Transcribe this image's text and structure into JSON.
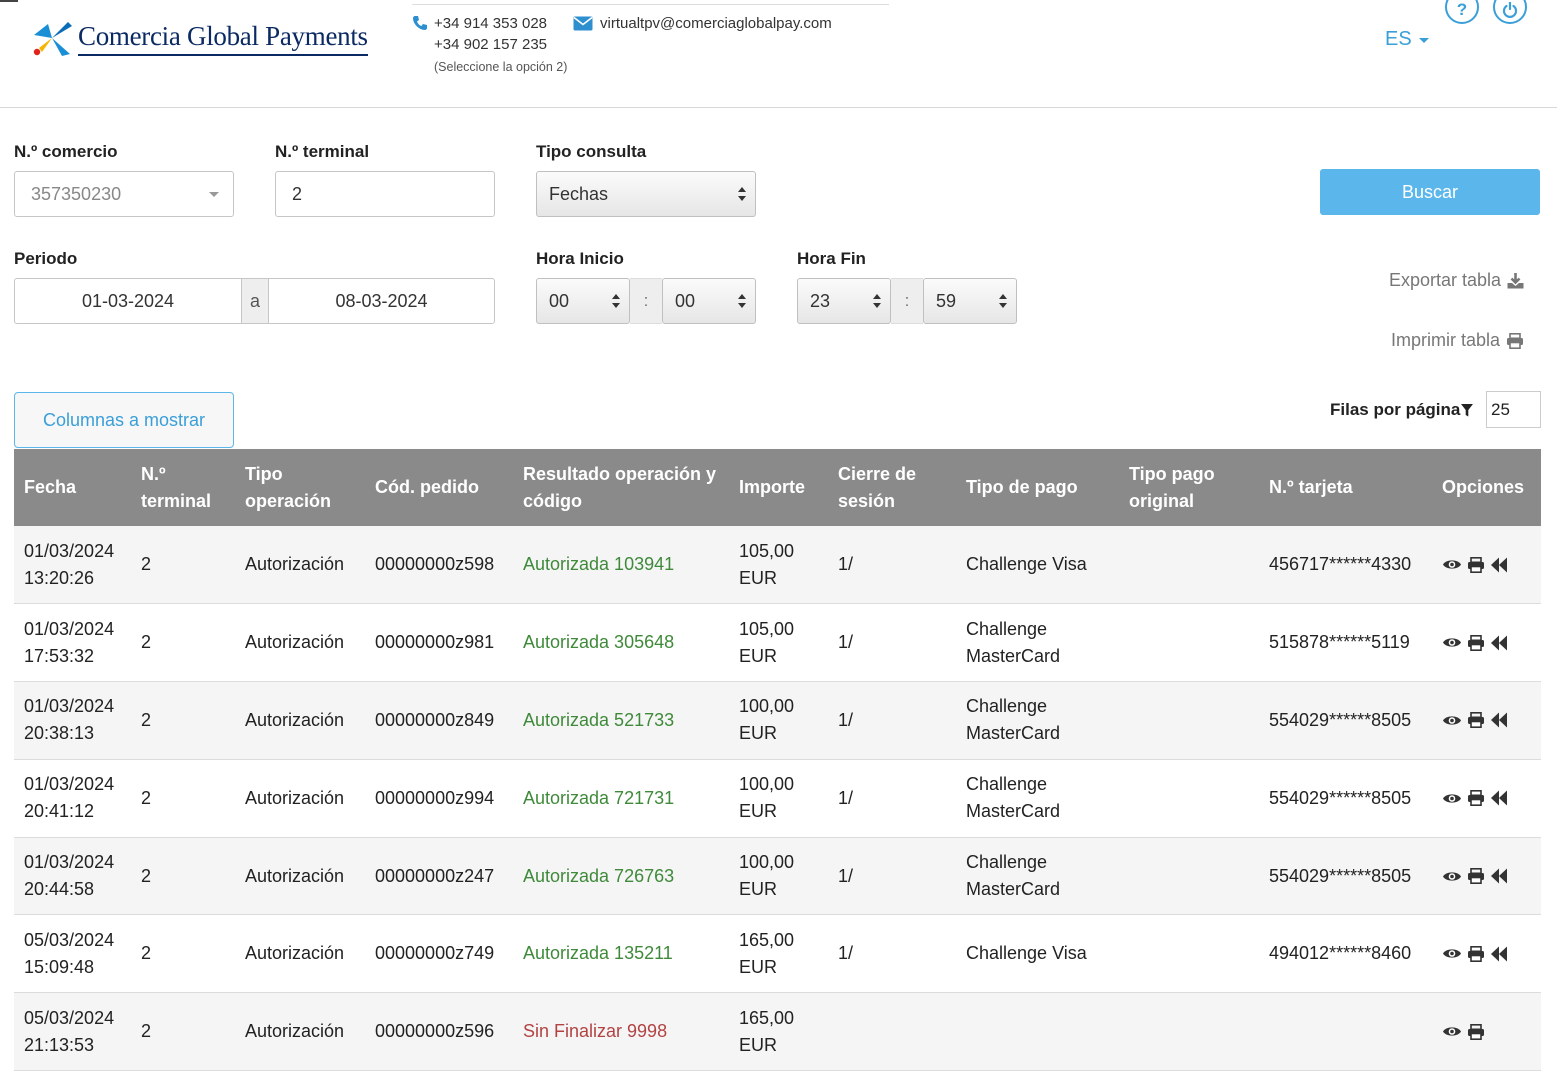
{
  "header": {
    "logo_text": "Comercia Global Payments",
    "phone1": "+34 914 353 028",
    "email": "virtualtpv@comerciaglobalpay.com",
    "phone2": "+34 902 157 235",
    "phone_note": "(Seleccione la opción 2)",
    "language": "ES",
    "help_label": "?"
  },
  "form": {
    "comercio_label": "N.º comercio",
    "comercio_value": "357350230",
    "terminal_label": "N.º terminal",
    "terminal_value": "2",
    "tipo_label": "Tipo consulta",
    "tipo_value": "Fechas",
    "periodo_label": "Periodo",
    "fecha_desde": "01-03-2024",
    "separator": "a",
    "fecha_hasta": "08-03-2024",
    "hora_inicio_label": "Hora Inicio",
    "hora_inicio_h": "00",
    "hora_inicio_m": "00",
    "hora_fin_label": "Hora Fin",
    "hora_fin_h": "23",
    "hora_fin_m": "59",
    "time_sep": ":",
    "buscar": "Buscar",
    "exportar": "Exportar tabla",
    "imprimir": "Imprimir tabla",
    "columnas": "Columnas a mostrar",
    "filas_label": "Filas por página",
    "filas_value": "25"
  },
  "accent_color": "#5bb6ec",
  "table": {
    "headers": [
      "Fecha",
      "N.º terminal",
      "Tipo operación",
      "Cód. pedido",
      "Resultado operación y código",
      "Importe",
      "Cierre de sesión",
      "Tipo de pago",
      "Tipo pago original",
      "N.º tarjeta",
      "Opciones"
    ],
    "rows": [
      {
        "fecha": "01/03/2024",
        "hora": "13:20:26",
        "terminal": "2",
        "tipo": "Autorización",
        "pedido": "00000000z598",
        "resultado": "Autorizada 103941",
        "status": "ok",
        "importe": "105,00",
        "moneda": "EUR",
        "cierre": "1/",
        "pago1": "Challenge Visa",
        "pago2": "",
        "original": "",
        "tarjeta": "456717******4330",
        "opciones": [
          "eye-icon",
          "print-icon",
          "refund-icon"
        ]
      },
      {
        "fecha": "01/03/2024",
        "hora": "17:53:32",
        "terminal": "2",
        "tipo": "Autorización",
        "pedido": "00000000z981",
        "resultado": "Autorizada 305648",
        "status": "ok",
        "importe": "105,00",
        "moneda": "EUR",
        "cierre": "1/",
        "pago1": "Challenge",
        "pago2": "MasterCard",
        "original": "",
        "tarjeta": "515878******5119",
        "opciones": [
          "eye-icon",
          "print-icon",
          "refund-icon"
        ]
      },
      {
        "fecha": "01/03/2024",
        "hora": "20:38:13",
        "terminal": "2",
        "tipo": "Autorización",
        "pedido": "00000000z849",
        "resultado": "Autorizada 521733",
        "status": "ok",
        "importe": "100,00",
        "moneda": "EUR",
        "cierre": "1/",
        "pago1": "Challenge",
        "pago2": "MasterCard",
        "original": "",
        "tarjeta": "554029******8505",
        "opciones": [
          "eye-icon",
          "print-icon",
          "refund-icon"
        ]
      },
      {
        "fecha": "01/03/2024",
        "hora": "20:41:12",
        "terminal": "2",
        "tipo": "Autorización",
        "pedido": "00000000z994",
        "resultado": "Autorizada 721731",
        "status": "ok",
        "importe": "100,00",
        "moneda": "EUR",
        "cierre": "1/",
        "pago1": "Challenge",
        "pago2": "MasterCard",
        "original": "",
        "tarjeta": "554029******8505",
        "opciones": [
          "eye-icon",
          "print-icon",
          "refund-icon"
        ]
      },
      {
        "fecha": "01/03/2024",
        "hora": "20:44:58",
        "terminal": "2",
        "tipo": "Autorización",
        "pedido": "00000000z247",
        "resultado": "Autorizada 726763",
        "status": "ok",
        "importe": "100,00",
        "moneda": "EUR",
        "cierre": "1/",
        "pago1": "Challenge",
        "pago2": "MasterCard",
        "original": "",
        "tarjeta": "554029******8505",
        "opciones": [
          "eye-icon",
          "print-icon",
          "refund-icon"
        ]
      },
      {
        "fecha": "05/03/2024",
        "hora": "15:09:48",
        "terminal": "2",
        "tipo": "Autorización",
        "pedido": "00000000z749",
        "resultado": "Autorizada 135211",
        "status": "ok",
        "importe": "165,00",
        "moneda": "EUR",
        "cierre": "1/",
        "pago1": "Challenge Visa",
        "pago2": "",
        "original": "",
        "tarjeta": "494012******8460",
        "opciones": [
          "eye-icon",
          "print-icon",
          "refund-icon"
        ]
      },
      {
        "fecha": "05/03/2024",
        "hora": "21:13:53",
        "terminal": "2",
        "tipo": "Autorización",
        "pedido": "00000000z596",
        "resultado": "Sin Finalizar 9998",
        "status": "ko",
        "importe": "165,00",
        "moneda": "EUR",
        "cierre": "",
        "pago1": "",
        "pago2": "",
        "original": "",
        "tarjeta": "",
        "opciones": [
          "eye-icon",
          "print-icon"
        ]
      }
    ]
  }
}
